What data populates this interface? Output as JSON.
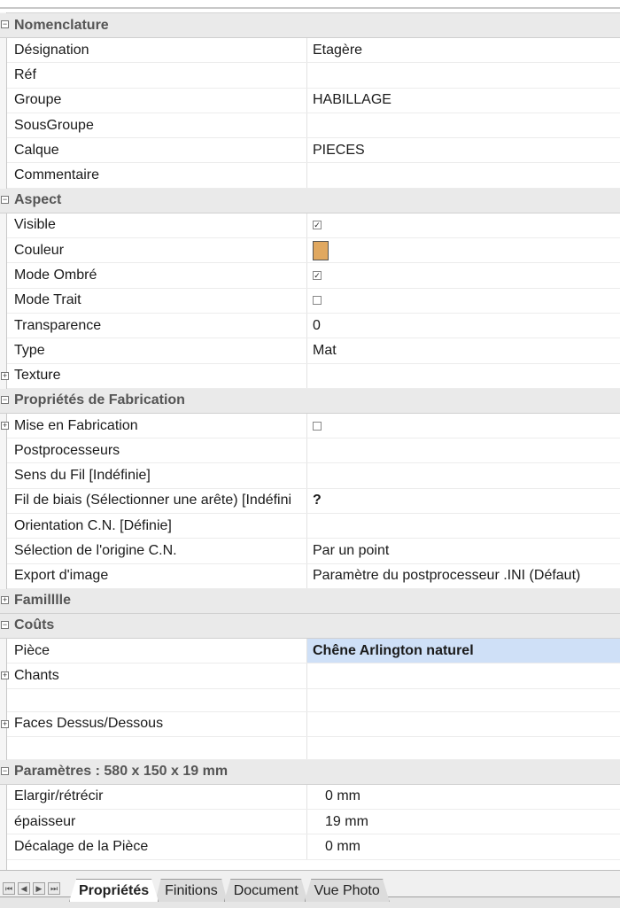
{
  "categories": {
    "nomenclature": "Nomenclature",
    "aspect": "Aspect",
    "fabrication": "Propriétés de Fabrication",
    "famille": "Familllle",
    "couts": "Coûts",
    "parametres": "Paramètres : 580 x 150 x 19 mm"
  },
  "nomenclature": [
    {
      "name": "Désignation",
      "value": "Etagère"
    },
    {
      "name": "Réf",
      "value": ""
    },
    {
      "name": "Groupe",
      "value": "HABILLAGE"
    },
    {
      "name": "SousGroupe",
      "value": ""
    },
    {
      "name": "Calque",
      "value": "PIECES"
    },
    {
      "name": "Commentaire",
      "value": ""
    }
  ],
  "aspect": {
    "visible": {
      "name": "Visible",
      "checked": true
    },
    "couleur": {
      "name": "Couleur",
      "color": "#e0a860"
    },
    "mode_ombre": {
      "name": "Mode Ombré",
      "checked": true
    },
    "mode_trait": {
      "name": "Mode Trait",
      "checked": false
    },
    "transparence": {
      "name": "Transparence",
      "value": "0"
    },
    "type": {
      "name": "Type",
      "value": "Mat"
    },
    "texture": {
      "name": "Texture",
      "value": ""
    }
  },
  "fabrication": {
    "mise": {
      "name": "Mise en Fabrication",
      "checked": false
    },
    "postprocesseurs": {
      "name": "Postprocesseurs",
      "value": ""
    },
    "sens": {
      "name": "Sens du Fil [Indéfinie]",
      "value": ""
    },
    "biais": {
      "name": "Fil de biais (Sélectionner une arête) [Indéfini",
      "value": "?"
    },
    "orientation": {
      "name": "Orientation C.N. [Définie]",
      "value": ""
    },
    "origine": {
      "name": "Sélection de l'origine C.N.",
      "value": "Par un point"
    },
    "export": {
      "name": "Export d'image",
      "value": "Paramètre du postprocesseur .INI (Défaut)"
    }
  },
  "couts": {
    "piece": {
      "name": "Pièce",
      "value": "Chêne Arlington naturel"
    },
    "chants": {
      "name": "Chants",
      "value": ""
    },
    "faces": {
      "name": "Faces Dessus/Dessous",
      "value": ""
    }
  },
  "parametres": [
    {
      "name": "Elargir/rétrécir",
      "value": "0 mm"
    },
    {
      "name": "épaisseur",
      "value": "19 mm"
    },
    {
      "name": "Décalage de la Pièce",
      "value": "0 mm"
    }
  ],
  "tabs": {
    "proprietes": "Propriétés",
    "finitions": "Finitions",
    "document": "Document",
    "vue_photo": "Vue Photo"
  },
  "nav_icons": [
    "first-icon",
    "prev-icon",
    "next-icon",
    "last-icon"
  ]
}
